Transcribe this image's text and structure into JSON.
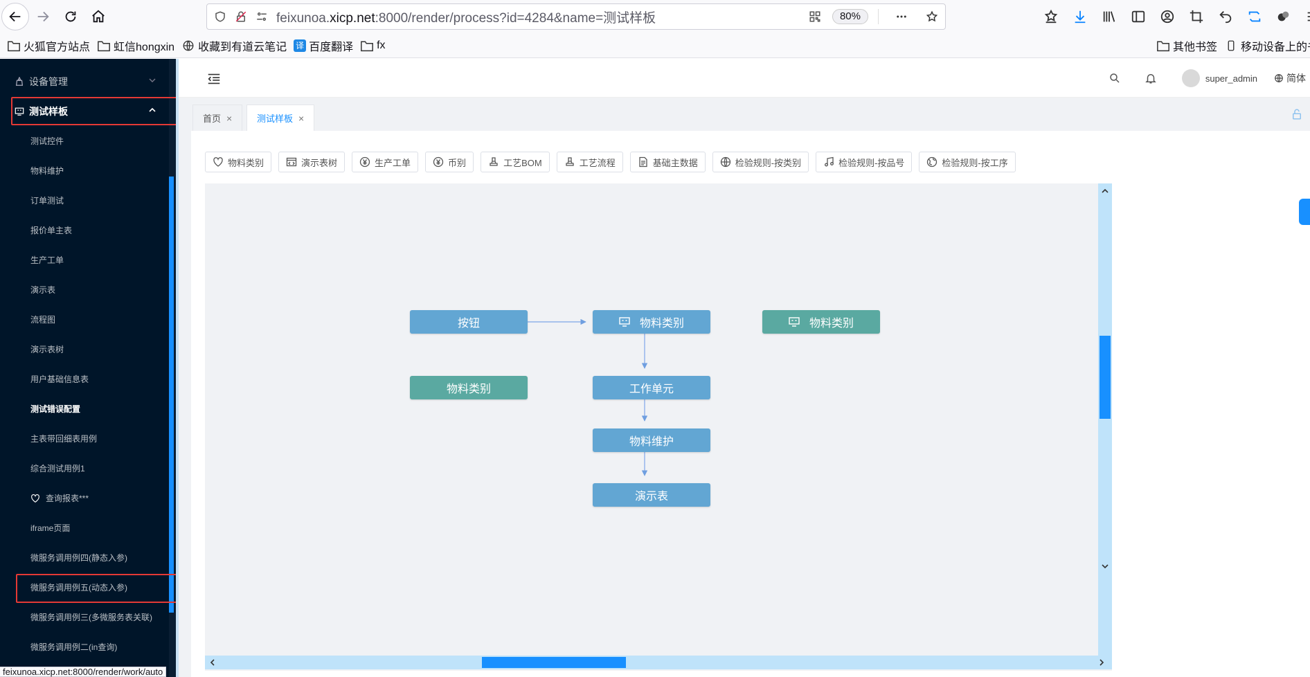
{
  "browser": {
    "url_prefix": "feixunoa.",
    "url_domain": "xicp.net",
    "url_suffix": ":8000/render/process?id=4284&name=测试样板",
    "zoom": "80%",
    "status_url": "feixunoa.xicp.net:8000/render/work/auto"
  },
  "bookmarks": {
    "items": [
      "火狐官方站点",
      "虹信hongxin",
      "收藏到有道云笔记",
      "百度翻译",
      "fx"
    ],
    "translate_glyph": "译",
    "right": [
      "其他书签",
      "移动设备上的书签"
    ]
  },
  "sidebar": {
    "groups": [
      {
        "label": "设备管理"
      },
      {
        "label": "测试样板"
      }
    ],
    "items": [
      {
        "label": "测试控件"
      },
      {
        "label": "物料维护"
      },
      {
        "label": "订单测试"
      },
      {
        "label": "报价单主表"
      },
      {
        "label": "生产工单"
      },
      {
        "label": "演示表"
      },
      {
        "label": "流程图"
      },
      {
        "label": "演示表树"
      },
      {
        "label": "用户基础信息表"
      },
      {
        "label": "测试错误配置"
      },
      {
        "label": "主表带回细表用例"
      },
      {
        "label": "综合测试用例1"
      },
      {
        "label": "查询报表***"
      },
      {
        "label": "iframe页面"
      },
      {
        "label": "微服务调用例四(静态入参)"
      },
      {
        "label": "微服务调用例五(动态入参)"
      },
      {
        "label": "微服务调用例三(多微服务表关联)"
      },
      {
        "label": "微服务调用例二(in查询)"
      }
    ]
  },
  "header": {
    "username": "super_admin",
    "language": "简体"
  },
  "tabs": [
    {
      "label": "首页"
    },
    {
      "label": "测试样板"
    }
  ],
  "toolbar": {
    "buttons": [
      {
        "label": "物料类别"
      },
      {
        "label": "演示表树"
      },
      {
        "label": "生产工单"
      },
      {
        "label": "币别"
      },
      {
        "label": "工艺BOM"
      },
      {
        "label": "工艺流程"
      },
      {
        "label": "基础主数据"
      },
      {
        "label": "检验规则-按类别"
      },
      {
        "label": "检验规则-按品号"
      },
      {
        "label": "检验规则-按工序"
      }
    ]
  },
  "flow": {
    "nodes": [
      {
        "id": "n1",
        "label": "按钮",
        "color": "#62a6d3"
      },
      {
        "id": "n2",
        "label": "物料类别",
        "color": "#62a6d3"
      },
      {
        "id": "n3",
        "label": "物料类别",
        "color": "#5aa9a1"
      },
      {
        "id": "n4",
        "label": "物料类别",
        "color": "#5aa9a1"
      },
      {
        "id": "n5",
        "label": "工作单元",
        "color": "#62a6d3"
      },
      {
        "id": "n6",
        "label": "物料维护",
        "color": "#62a6d3"
      },
      {
        "id": "n7",
        "label": "演示表",
        "color": "#62a6d3"
      }
    ],
    "edges": [
      {
        "from": "n1",
        "to": "n2"
      },
      {
        "from": "n2",
        "to": "n5"
      },
      {
        "from": "n5",
        "to": "n6"
      },
      {
        "from": "n6",
        "to": "n7"
      }
    ]
  },
  "colors": {
    "sidebar_bg": "#001529",
    "accent": "#1890ff",
    "highlight_box": "#e53935"
  }
}
